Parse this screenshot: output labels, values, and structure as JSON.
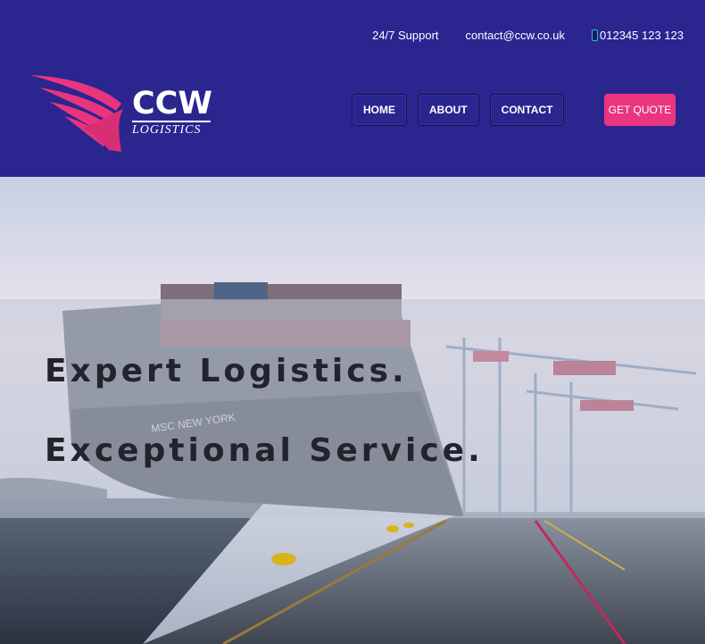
{
  "topbar": {
    "support": "24/7 Support",
    "email": "contact@ccw.co.uk",
    "phone": "012345 123 123"
  },
  "logo": {
    "name": "CCW",
    "tagline": "LOGISTICS"
  },
  "nav": {
    "items": [
      {
        "label": "HOME"
      },
      {
        "label": "ABOUT"
      },
      {
        "label": "CONTACT"
      }
    ],
    "cta": "GET QUOTE"
  },
  "hero": {
    "line1": "Expert Logistics.",
    "line2": "Exceptional Service.",
    "ship_name": "MSC NEW YORK"
  },
  "colors": {
    "header_bg": "#2b2590",
    "accent_pink": "#e9357e",
    "text_dark": "#22232c"
  }
}
